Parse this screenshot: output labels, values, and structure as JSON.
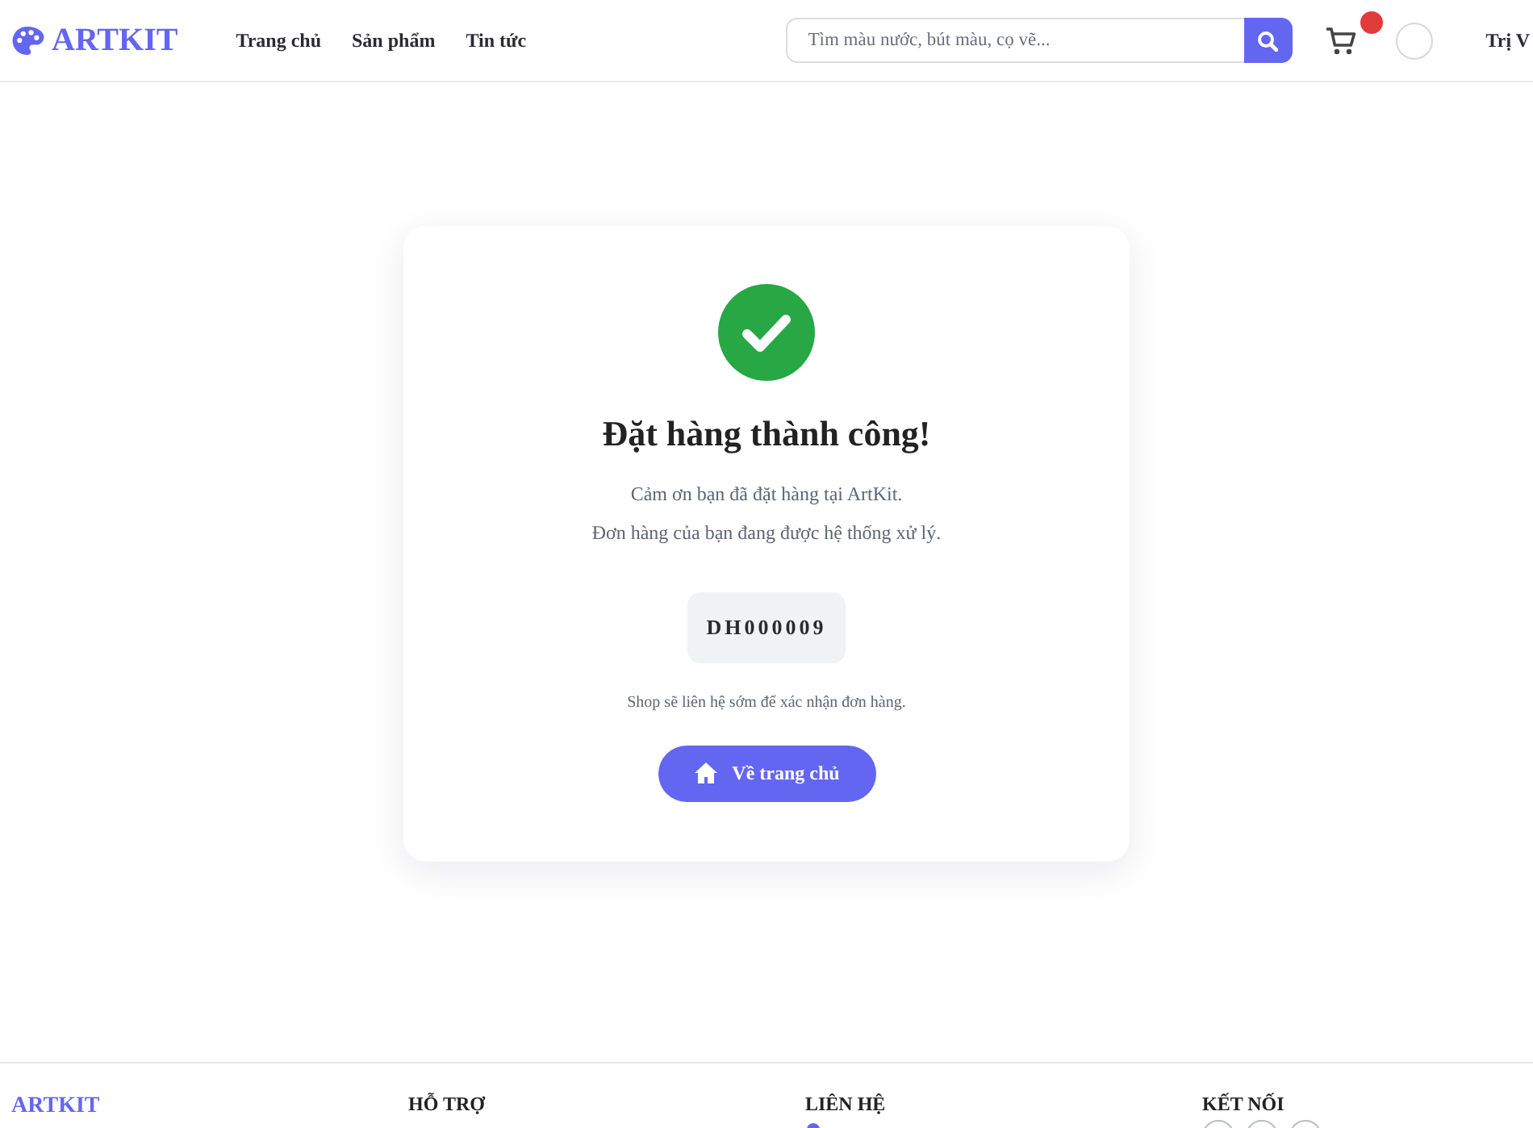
{
  "header": {
    "logo": "ARTKIT",
    "nav": [
      "Trang chủ",
      "Sản phẩm",
      "Tin tức"
    ],
    "search": {
      "placeholder": "Tìm màu nước, bút màu, cọ vẽ..."
    },
    "user": {
      "name": "Trị V"
    }
  },
  "confirmation": {
    "title": "Đặt hàng thành công!",
    "lines": [
      "Cảm ơn bạn đã đặt hàng tại ArtKit.",
      "Đơn hàng của bạn đang được hệ thống xử lý."
    ],
    "order_code": "DH000009",
    "note": "Shop sẽ liên hệ sớm để xác nhận đơn hàng.",
    "button": "Về trang chủ"
  },
  "footer": {
    "brand": "ARTKIT",
    "columns": [
      {
        "kind": "links",
        "heading": "HỖ TRỢ"
      },
      {
        "kind": "contact",
        "heading": "LIÊN HỆ"
      },
      {
        "kind": "social",
        "heading": "KẾT NỐI"
      }
    ]
  }
}
